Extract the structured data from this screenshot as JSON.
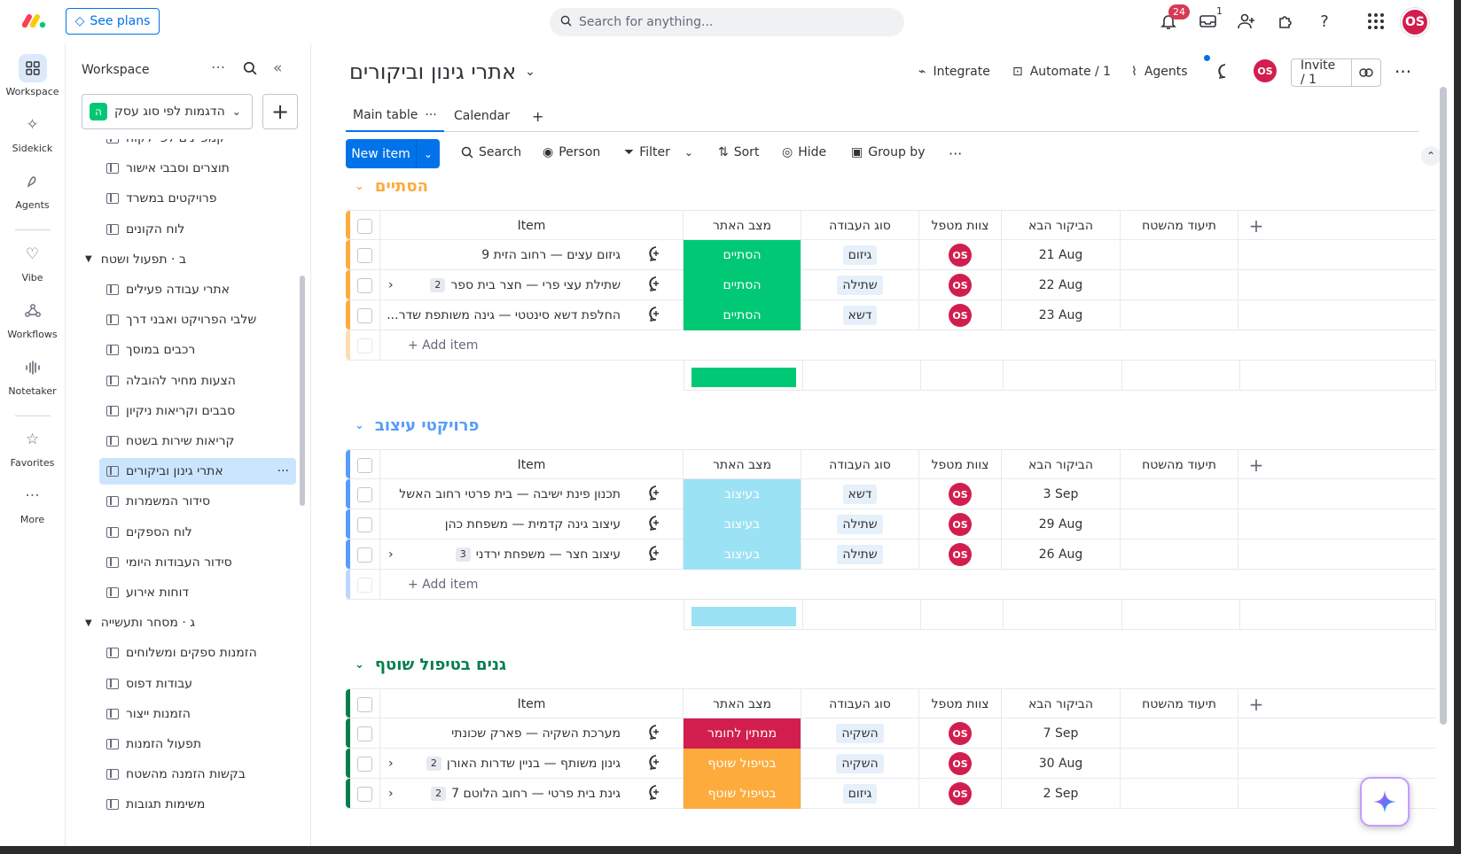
{
  "topbar": {
    "see_plans": "See plans",
    "search_placeholder": "Search for anything...",
    "notif_count": "24",
    "inbox_count": "1",
    "user_initials": "OS"
  },
  "leftnav": [
    {
      "label": "Workspace",
      "icon": "grid-icon"
    },
    {
      "label": "Sidekick",
      "icon": "sparkle-icon"
    },
    {
      "label": "Agents",
      "icon": "agents-icon"
    },
    {
      "label": "Vibe",
      "icon": "heart-icon"
    },
    {
      "label": "Workflows",
      "icon": "workflows-icon"
    },
    {
      "label": "Notetaker",
      "icon": "waveform-icon"
    },
    {
      "label": "Favorites",
      "icon": "star-icon"
    },
    {
      "label": "More",
      "icon": "ellipsis-icon"
    }
  ],
  "sidebar": {
    "title": "Workspace",
    "workspace_name": "הדגמות לפי סוג עסק",
    "workspace_letter": "ה",
    "items": [
      {
        "label": "קמפיינים לפי לקוח",
        "type": "board"
      },
      {
        "label": "תוצרים וסבבי אישור",
        "type": "board"
      },
      {
        "label": "פרויקטים במשרד",
        "type": "board"
      },
      {
        "label": "לוח הקונים",
        "type": "board"
      },
      {
        "label": "ב · תפעול ושטח",
        "type": "folder"
      },
      {
        "label": "אתרי עבודה פעילים",
        "type": "board"
      },
      {
        "label": "שלבי הפרויקט ואבני דרך",
        "type": "board"
      },
      {
        "label": "רכבים במוסך",
        "type": "board"
      },
      {
        "label": "הצעות מחיר להובלה",
        "type": "board"
      },
      {
        "label": "סבבים וקריאות ניקיון",
        "type": "board"
      },
      {
        "label": "קריאות שירות בשטח",
        "type": "board"
      },
      {
        "label": "אתרי גינון וביקורים",
        "type": "board",
        "active": true
      },
      {
        "label": "סידור המשמרות",
        "type": "board"
      },
      {
        "label": "לוח הספקים",
        "type": "board"
      },
      {
        "label": "סידור העבודות היומי",
        "type": "board"
      },
      {
        "label": "דוחות אירוע",
        "type": "board"
      },
      {
        "label": "ג · מסחר ותעשייה",
        "type": "folder"
      },
      {
        "label": "הזמנות ספקים ומשלוחים",
        "type": "board"
      },
      {
        "label": "עבודות דפוס",
        "type": "board"
      },
      {
        "label": "הזמנות ייצור",
        "type": "board"
      },
      {
        "label": "תפעול הזמנות",
        "type": "board"
      },
      {
        "label": "בקשות הזמנה מהשטח",
        "type": "board"
      },
      {
        "label": "משימות תגובות",
        "type": "board"
      }
    ]
  },
  "board": {
    "title": "אתרי גינון וביקורים",
    "integrate": "Integrate",
    "automate": "Automate / 1",
    "agents": "Agents",
    "invite": "Invite / 1",
    "tabs": [
      "Main table",
      "Calendar"
    ],
    "toolbar": {
      "new_item": "New item",
      "search": "Search",
      "person": "Person",
      "filter": "Filter",
      "sort": "Sort",
      "hide": "Hide",
      "group_by": "Group by"
    },
    "columns": {
      "item": "Item",
      "status": "מצב האתר",
      "type": "סוג העבודה",
      "team": "צוות מטפל",
      "next_visit": "הביקור הבא",
      "field_doc": "תיעוד מהשטח"
    },
    "add_item": "+ Add item",
    "groups": [
      {
        "title": "הסתיים",
        "color": "#fdab3d",
        "summary_color": "#00c875",
        "rows": [
          {
            "name": "גיזום עצים — רחוב הזית 9",
            "sub": "",
            "status": "הסתיים",
            "status_color": "#00c875",
            "type": "גיזום",
            "owner": "OS",
            "date": "21 Aug"
          },
          {
            "name": "שתילת עצי פרי — חצר בית ספר",
            "sub": "2",
            "status": "הסתיים",
            "status_color": "#00c875",
            "type": "שתילה",
            "owner": "OS",
            "date": "22 Aug"
          },
          {
            "name": "החלפת דשא סינטטי — גינה משותפת שדר...",
            "sub": "",
            "status": "הסתיים",
            "status_color": "#00c875",
            "type": "דשא",
            "owner": "OS",
            "date": "23 Aug"
          }
        ]
      },
      {
        "title": "פרויקטי עיצוב",
        "color": "#579bfc",
        "summary_color": "#9ce2f5",
        "rows": [
          {
            "name": "תכנון פינת ישיבה — בית פרטי רחוב האשל",
            "sub": "",
            "status": "בעיצוב",
            "status_color": "#9ce2f5",
            "type": "דשא",
            "owner": "OS",
            "date": "3 Sep"
          },
          {
            "name": "עיצוב גינה קדמית — משפחת כהן",
            "sub": "",
            "status": "בעיצוב",
            "status_color": "#9ce2f5",
            "type": "שתילה",
            "owner": "OS",
            "date": "29 Aug"
          },
          {
            "name": "עיצוב חצר — משפחת ירדני",
            "sub": "3",
            "status": "בעיצוב",
            "status_color": "#9ce2f5",
            "type": "שתילה",
            "owner": "OS",
            "date": "26 Aug"
          }
        ]
      },
      {
        "title": "גנים בטיפול שוטף",
        "color": "#037f4c",
        "summary_color": "",
        "rows": [
          {
            "name": "מערכת השקיה — פארק שכונתי",
            "sub": "",
            "status": "ממתין לחומר",
            "status_color": "#d21e4e",
            "type": "השקיה",
            "owner": "OS",
            "date": "7 Sep"
          },
          {
            "name": "גינון משותף — בניין שדרות האורן",
            "sub": "2",
            "status": "בטיפול שוטף",
            "status_color": "#fdab3d",
            "type": "השקיה",
            "owner": "OS",
            "date": "30 Aug"
          },
          {
            "name": "גינת בית פרטי — רחוב הלוטם 7",
            "sub": "2",
            "status": "בטיפול שוטף",
            "status_color": "#fdab3d",
            "type": "גיזום",
            "owner": "OS",
            "date": "2 Sep"
          }
        ]
      }
    ]
  }
}
